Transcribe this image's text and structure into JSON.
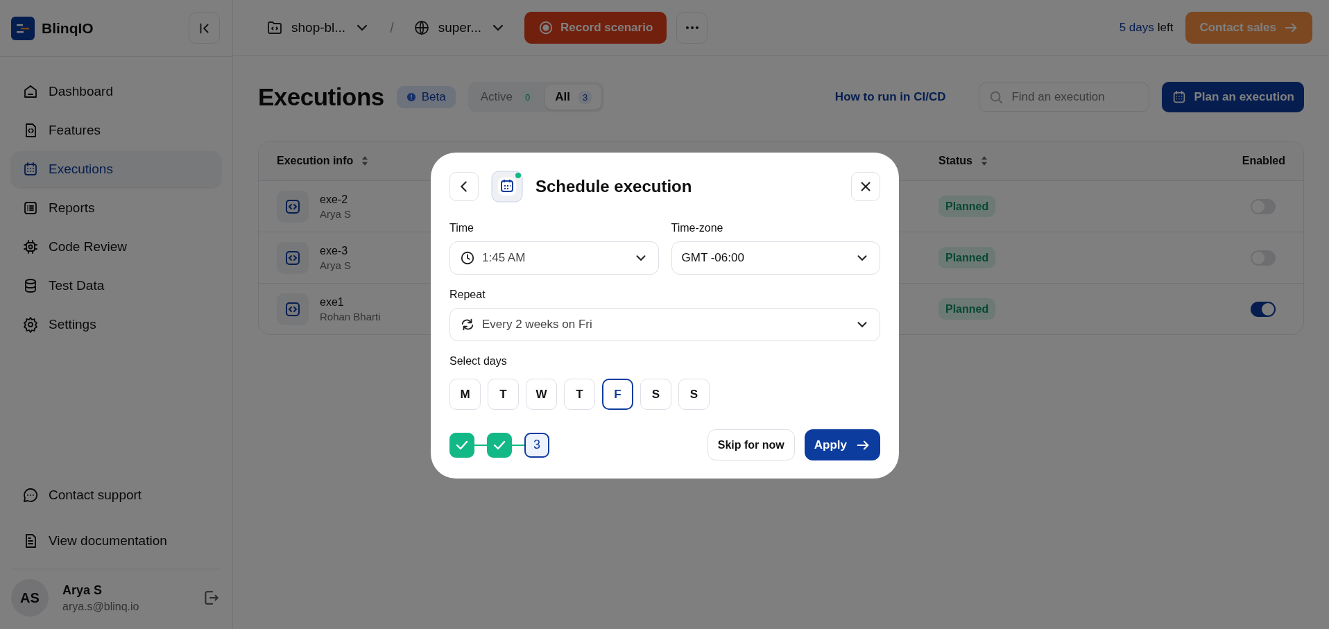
{
  "brand": {
    "name": "BlinqIO"
  },
  "topbar": {
    "project": "shop-bl...",
    "separator": "/",
    "environment": "super...",
    "record_button": "Record scenario",
    "trial_count": "5 days",
    "trial_suffix": "left",
    "contact_button": "Contact sales"
  },
  "sidebar": {
    "items": [
      {
        "label": "Dashboard",
        "kind": "home",
        "selected": false
      },
      {
        "label": "Features",
        "kind": "file-code",
        "selected": false
      },
      {
        "label": "Executions",
        "kind": "calendar",
        "selected": true
      },
      {
        "label": "Reports",
        "kind": "list",
        "selected": false
      },
      {
        "label": "Code Review",
        "kind": "chip",
        "selected": false
      },
      {
        "label": "Test Data",
        "kind": "database",
        "selected": false
      },
      {
        "label": "Settings",
        "kind": "gear",
        "selected": false
      }
    ],
    "footer_items": [
      {
        "label": "Contact support",
        "kind": "chat"
      },
      {
        "label": "View documentation",
        "kind": "doc"
      }
    ],
    "user": {
      "initials": "AS",
      "name": "Arya S",
      "email": "arya.s@blinq.io"
    }
  },
  "page": {
    "title": "Executions",
    "badge": "Beta",
    "filters": [
      {
        "label": "Active",
        "count": "0",
        "selected": false
      },
      {
        "label": "All",
        "count": "3",
        "selected": true
      }
    ],
    "ci_link": "How to run in CI/CD",
    "search": {
      "placeholder": "Find an execution"
    },
    "plan_button": "Plan an execution"
  },
  "table": {
    "columns": [
      {
        "label": "Execution info",
        "sortable": true
      },
      {
        "label": "Status",
        "sortable": true
      },
      {
        "label": "Enabled",
        "sortable": false
      }
    ],
    "rows": [
      {
        "name": "exe-2",
        "owner": "Arya S",
        "status": "Planned",
        "enabled": false
      },
      {
        "name": "exe-3",
        "owner": "Arya S",
        "status": "Planned",
        "enabled": false
      },
      {
        "name": "exe1",
        "owner": "Rohan Bharti",
        "status": "Planned",
        "enabled": true
      }
    ]
  },
  "modal": {
    "title": "Schedule execution",
    "time_label": "Time",
    "time_value": "1:45 AM",
    "timezone_label": "Time-zone",
    "timezone_value": "GMT -06:00",
    "repeat_label": "Repeat",
    "repeat_value": "Every 2 weeks on Fri",
    "days_label": "Select days",
    "days": [
      {
        "label": "M",
        "selected": false
      },
      {
        "label": "T",
        "selected": false
      },
      {
        "label": "W",
        "selected": false
      },
      {
        "label": "T",
        "selected": false
      },
      {
        "label": "F",
        "selected": true
      },
      {
        "label": "S",
        "selected": false
      },
      {
        "label": "S",
        "selected": false
      }
    ],
    "steps": [
      {
        "done": true
      },
      {
        "done": true
      },
      {
        "done": false,
        "label": "3"
      }
    ],
    "skip_button": "Skip for now",
    "apply_button": "Apply"
  }
}
